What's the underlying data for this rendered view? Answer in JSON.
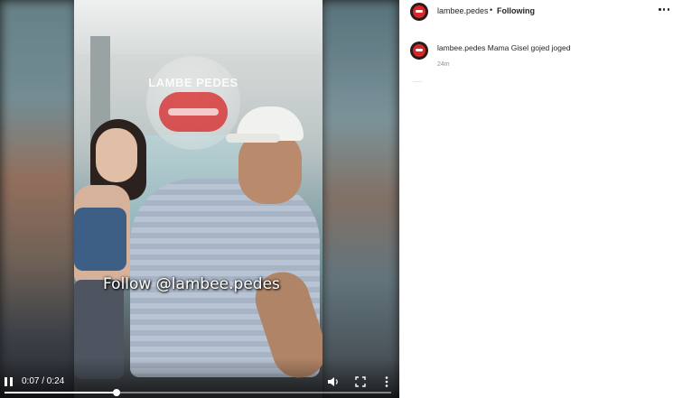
{
  "video": {
    "watermark_text": "Follow @lambee.pedes",
    "logo_text": "LAMBE PEDES",
    "time_display": "0:07 / 0:24",
    "progress_fraction": 0.29,
    "icons": {
      "play_pause": "pause-icon",
      "volume": "volume-icon",
      "fullscreen": "fullscreen-icon",
      "more": "more-vertical-icon"
    }
  },
  "post": {
    "username": "lambee.pedes",
    "separator": "•",
    "follow_status": "Following",
    "more_icon": "more-horizontal-icon"
  },
  "caption": {
    "username": "lambee.pedes",
    "text": "Mama Gisel gojed joged",
    "timestamp": "24m"
  },
  "colors": {
    "accent": "#d42a2a",
    "text": "#262626",
    "muted": "#8e8e8e"
  }
}
